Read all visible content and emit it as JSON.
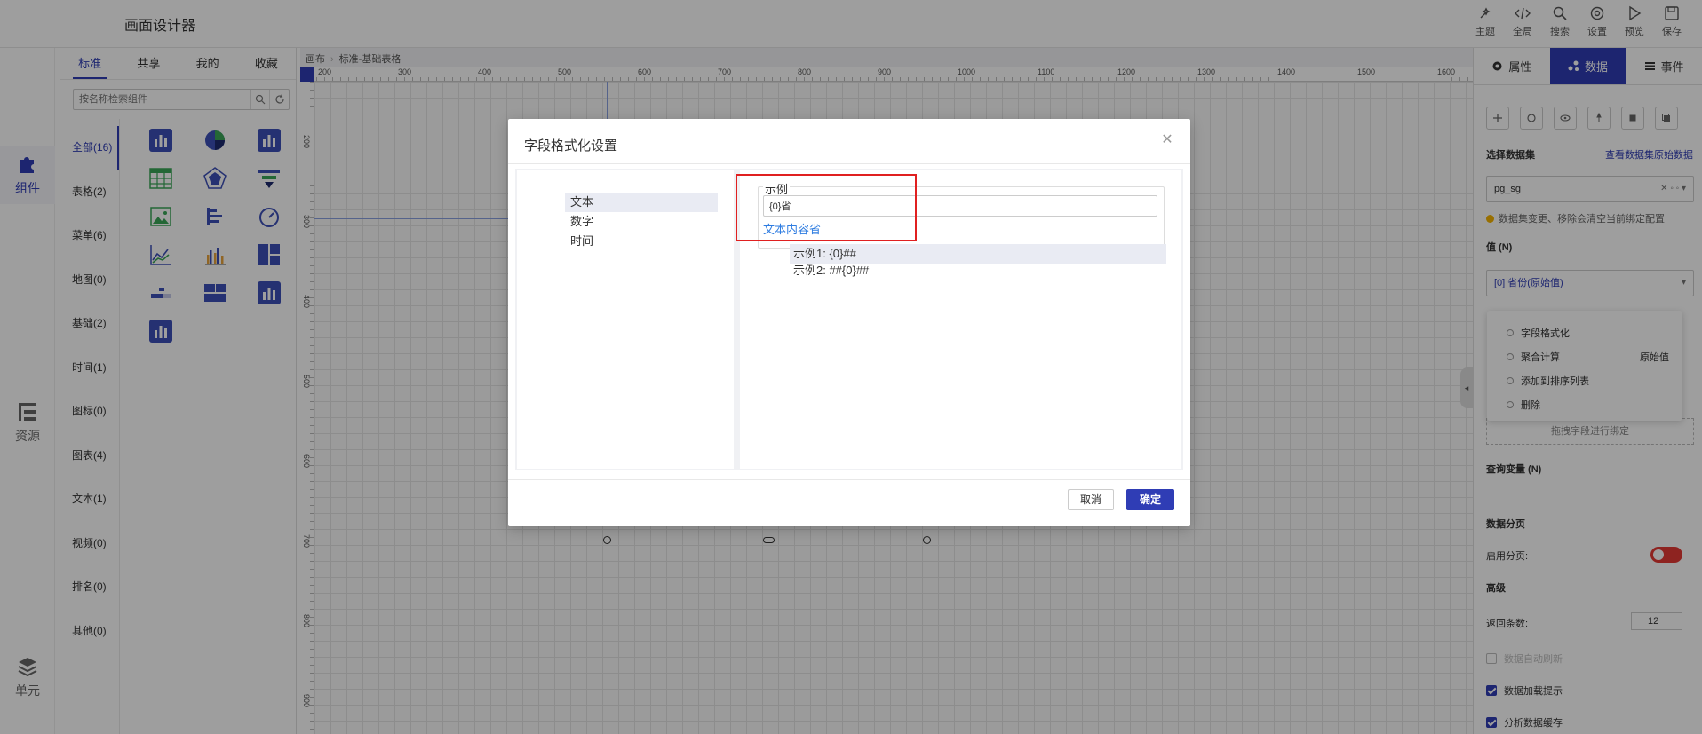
{
  "app": {
    "title": "画面设计器"
  },
  "toolbar": {
    "items": [
      {
        "label": "主题",
        "icon": "theme-icon"
      },
      {
        "label": "全局",
        "icon": "code-icon"
      },
      {
        "label": "搜索",
        "icon": "search-icon"
      },
      {
        "label": "设置",
        "icon": "gear-icon"
      },
      {
        "label": "预览",
        "icon": "play-icon"
      },
      {
        "label": "保存",
        "icon": "save-icon"
      }
    ]
  },
  "rail": {
    "items": [
      {
        "label": "组件",
        "icon": "puzzle-icon",
        "active": true
      },
      {
        "label": "资源",
        "icon": "tree-icon",
        "active": false
      },
      {
        "label": "单元",
        "icon": "layers-icon",
        "active": false
      }
    ]
  },
  "components": {
    "tabs": [
      "标准",
      "共享",
      "我的",
      "收藏"
    ],
    "active_tab": "标准",
    "search_placeholder": "按名称检索组件",
    "categories": [
      "全部(16)",
      "表格(2)",
      "菜单(6)",
      "地图(0)",
      "基础(2)",
      "时间(1)",
      "图标(0)",
      "图表(4)",
      "文本(1)",
      "视频(0)",
      "排名(0)",
      "其他(0)"
    ],
    "active_category": "全部(16)"
  },
  "canvas": {
    "breadcrumb": [
      "画布",
      "标准-基础表格"
    ],
    "ruler_h": [
      "200",
      "300",
      "400",
      "500",
      "600",
      "700",
      "800",
      "900",
      "1000",
      "1100",
      "1200",
      "1300",
      "1400",
      "1500",
      "1600"
    ],
    "ruler_v": [
      "200",
      "300",
      "400",
      "500",
      "600",
      "700",
      "800",
      "900"
    ]
  },
  "right_panel": {
    "tabs": [
      {
        "label": "属性",
        "icon": "gear-icon"
      },
      {
        "label": "数据",
        "icon": "data-icon"
      },
      {
        "label": "事件",
        "icon": "list-icon"
      }
    ],
    "active_tab": "数据",
    "dataset_label": "选择数据集",
    "view_raw_link": "查看数据集原始数据",
    "dataset_value": "pg_sg",
    "warning": "数据集变更、移除会清空当前绑定配置",
    "value_label": "值 (N)",
    "value_field": "[0] 省份(原始值)",
    "menu": {
      "format": "字段格式化",
      "aggregate": "聚合计算",
      "aggregate_value": "原始值",
      "add_sort": "添加到排序列表",
      "delete": "删除"
    },
    "drop_hint": "拖拽字段进行绑定",
    "query_var_label": "查询变量 (N)",
    "paging_label": "数据分页",
    "enable_paging": "启用分页:",
    "advanced": "高级",
    "return_count_label": "返回条数:",
    "return_count": "12",
    "auto_refresh": "数据自动刷新",
    "loading_hint": "数据加载提示",
    "cache": "分析数据缓存"
  },
  "modal": {
    "title": "字段格式化设置",
    "types": [
      "文本",
      "数字",
      "时间"
    ],
    "active_type": "文本",
    "example_legend": "示例",
    "format_input": "{0}省",
    "format_result": "文本内容省",
    "examples": [
      "示例1: {0}##",
      "示例2: ##{0}##"
    ],
    "cancel": "取消",
    "ok": "确定"
  }
}
